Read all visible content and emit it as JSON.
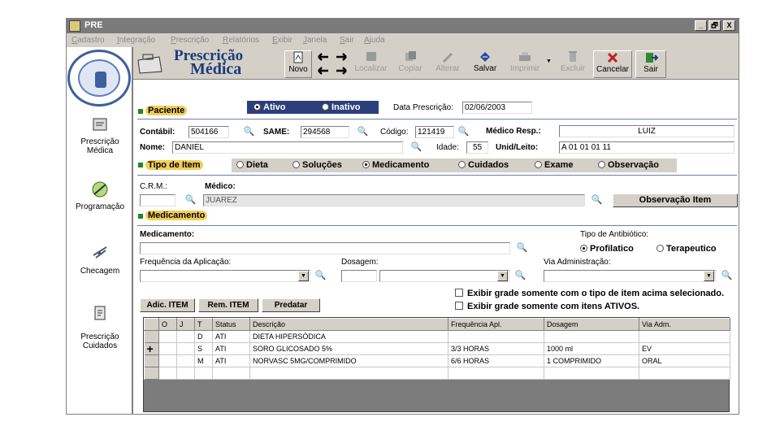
{
  "window": {
    "title": "PRE",
    "controls": [
      "_",
      "🗗",
      "X"
    ]
  },
  "menu": [
    "Cadastro",
    "Integração",
    "Prescrição",
    "Relatórios",
    "Exibir",
    "Janela",
    "Sair",
    "Ajuda"
  ],
  "sidebar": [
    {
      "label": "Prescrição Médica",
      "icon": "prescription-icon"
    },
    {
      "label": "Programação",
      "icon": "syringe-icon"
    },
    {
      "label": "Checagem",
      "icon": "check-icon"
    },
    {
      "label": "Prescrição Cuidados",
      "icon": "care-icon"
    }
  ],
  "header": {
    "title_line1": "Prescrição",
    "title_line2": "Médica"
  },
  "toolbar": {
    "novo": "Novo",
    "localizar": "Localizar",
    "copiar": "Copiar",
    "alterar": "Alterar",
    "salvar": "Salvar",
    "imprimir": "Imprimir",
    "excluir": "Excluir",
    "cancelar": "Cancelar",
    "sair": "Sair"
  },
  "patient": {
    "section": "Paciente",
    "ativo": "Ativo",
    "inativo": "Inativo",
    "data_prescricao_label": "Data Prescrição:",
    "data_prescricao": "02/06/2003",
    "contabil_label": "Contábil:",
    "contabil": "504166",
    "same_label": "SAME:",
    "same": "294568",
    "codigo_label": "Código:",
    "codigo": "121419",
    "medico_resp_label": "Médico Resp.:",
    "medico_resp": "LUIZ",
    "nome_label": "Nome:",
    "nome": "DANIEL",
    "idade_label": "Idade:",
    "idade": "55",
    "unid_label": "Unid/Leito:",
    "unid": "A 01 01 01 11"
  },
  "item_type": {
    "section": "Tipo de Item",
    "options": [
      "Dieta",
      "Soluções",
      "Medicamento",
      "Cuidados",
      "Exame",
      "Observação"
    ],
    "selected": "Medicamento"
  },
  "doctor": {
    "crm_label": "C.R.M.:",
    "crm": "",
    "medico_label": "Médico:",
    "medico": "JUAREZ",
    "observacao_button": "Observação Item"
  },
  "medication": {
    "section": "Medicamento",
    "medicamento_label": "Medicamento:",
    "medicamento": "",
    "antibiotico_label": "Tipo de Antibiótico:",
    "profilatico": "Profilatico",
    "terapeutico": "Terapeutico",
    "frequencia_label": "Frequência da Aplicação:",
    "frequencia": "",
    "dosagem_label": "Dosagem:",
    "dosagem_qtd": "",
    "dosagem": "",
    "via_label": "Via Administração:",
    "via": ""
  },
  "actions": {
    "adicionar": "Adic. ITEM",
    "remover": "Rem. ITEM",
    "predatar": "Predatar",
    "filtro_tipo": "Exibir grade somente com o tipo de item acima selecionado.",
    "filtro_ativos": "Exibir grade somente com itens ATIVOS."
  },
  "grid": {
    "columns": [
      "O",
      "J",
      "T",
      "Status",
      "Descrição",
      "Frequência Apl.",
      "Dosagem",
      "Via Adm."
    ],
    "rows": [
      {
        "indicator": "",
        "o": "",
        "j": "",
        "t": "D",
        "status": "ATI",
        "descricao": "DIETA HIPERSÓDICA",
        "frequencia": "",
        "dosagem": "",
        "via": ""
      },
      {
        "indicator": "+",
        "o": "",
        "j": "",
        "t": "S",
        "status": "ATI",
        "descricao": "SORO GLICOSADO 5%",
        "frequencia": "3/3 HORAS",
        "dosagem": "1000 ml",
        "via": "EV"
      },
      {
        "indicator": "",
        "o": "",
        "j": "",
        "t": "M",
        "status": "ATI",
        "descricao": "NORVASC 5MG/COMPRIMIDO",
        "frequencia": "6/6 HORAS",
        "dosagem": "1 COMPRIMIDO",
        "via": "ORAL"
      }
    ]
  }
}
